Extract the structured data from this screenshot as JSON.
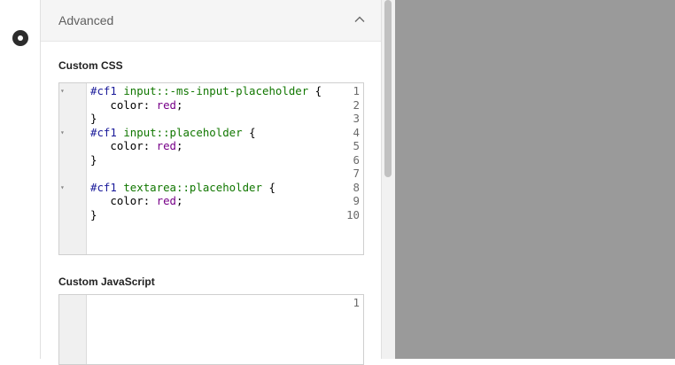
{
  "section": {
    "title": "Advanced"
  },
  "icons": {
    "collapse": "chevron-up-icon",
    "radio": "radio-selected-icon",
    "fold": "fold-arrow-icon"
  },
  "custom_css": {
    "label": "Custom CSS",
    "lines": [
      {
        "num": "1",
        "fold": "▾",
        "tokens": [
          [
            "sel",
            "#cf1"
          ],
          [
            "punc",
            " "
          ],
          [
            "tag",
            "input"
          ],
          [
            "pseudo",
            "::-ms-input-placeholder"
          ],
          [
            "punc",
            " {"
          ]
        ]
      },
      {
        "num": "2",
        "fold": "",
        "tokens": [
          [
            "punc",
            "   "
          ],
          [
            "prop",
            "color"
          ],
          [
            "punc",
            ": "
          ],
          [
            "val",
            "red"
          ],
          [
            "punc",
            ";"
          ]
        ]
      },
      {
        "num": "3",
        "fold": "",
        "tokens": [
          [
            "punc",
            "}"
          ]
        ]
      },
      {
        "num": "4",
        "fold": "▾",
        "tokens": [
          [
            "sel",
            "#cf1"
          ],
          [
            "punc",
            " "
          ],
          [
            "tag",
            "input"
          ],
          [
            "pseudo",
            "::placeholder"
          ],
          [
            "punc",
            " {"
          ]
        ]
      },
      {
        "num": "5",
        "fold": "",
        "tokens": [
          [
            "punc",
            "   "
          ],
          [
            "prop",
            "color"
          ],
          [
            "punc",
            ": "
          ],
          [
            "val",
            "red"
          ],
          [
            "punc",
            ";"
          ]
        ]
      },
      {
        "num": "6",
        "fold": "",
        "tokens": [
          [
            "punc",
            "}"
          ]
        ]
      },
      {
        "num": "7",
        "fold": "",
        "tokens": []
      },
      {
        "num": "8",
        "fold": "▾",
        "tokens": [
          [
            "sel",
            "#cf1"
          ],
          [
            "punc",
            " "
          ],
          [
            "tag",
            "textarea"
          ],
          [
            "pseudo",
            "::placeholder"
          ],
          [
            "punc",
            " {"
          ]
        ]
      },
      {
        "num": "9",
        "fold": "",
        "tokens": [
          [
            "punc",
            "   "
          ],
          [
            "prop",
            "color"
          ],
          [
            "punc",
            ": "
          ],
          [
            "val",
            "red"
          ],
          [
            "punc",
            ";"
          ]
        ]
      },
      {
        "num": "10",
        "fold": "",
        "tokens": [
          [
            "punc",
            "}"
          ]
        ]
      }
    ]
  },
  "custom_js": {
    "label": "Custom JavaScript",
    "lines": [
      {
        "num": "1",
        "fold": "",
        "tokens": []
      }
    ]
  }
}
